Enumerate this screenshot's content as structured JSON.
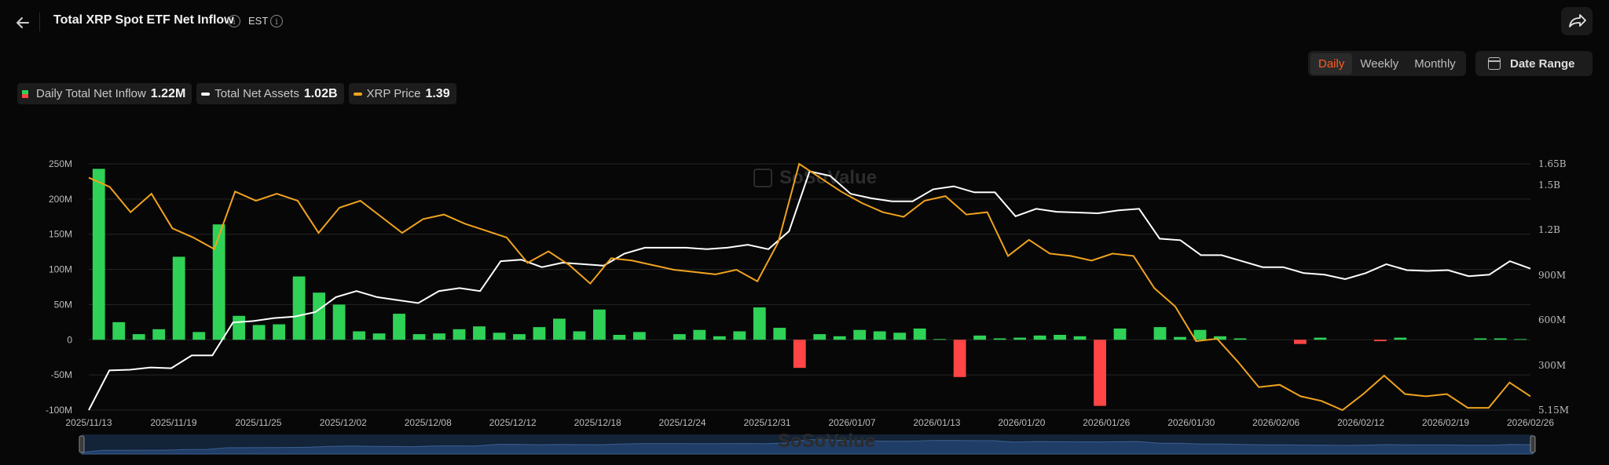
{
  "header": {
    "title": "Total XRP Spot ETF Net Inflow",
    "timezone": "EST"
  },
  "controls": {
    "periods": [
      "Daily",
      "Weekly",
      "Monthly"
    ],
    "active_period": "Daily",
    "date_range_label": "Date Range"
  },
  "legend": {
    "inflow": {
      "name": "Daily Total Net Inflow",
      "value": "1.22M"
    },
    "assets": {
      "name": "Total Net Assets",
      "value": "1.02B"
    },
    "price": {
      "name": "XRP Price",
      "value": "1.39"
    }
  },
  "watermark": "SoSoValue",
  "colors": {
    "positive": "#2fd157",
    "negative": "#ff4545",
    "assets_line": "#ffffff",
    "price_line": "#f0a31e",
    "accent": "#ff5a1f"
  },
  "chart_data": {
    "type": "bar",
    "x_tick_labels": [
      "2025/11/13",
      "2025/11/19",
      "2025/11/25",
      "2025/12/02",
      "2025/12/08",
      "2025/12/12",
      "2025/12/18",
      "2025/12/24",
      "2025/12/31",
      "2026/01/07",
      "2026/01/13",
      "2026/01/20",
      "2026/01/26",
      "2026/01/30",
      "2026/02/06",
      "2026/02/12",
      "2026/02/19",
      "2026/02/26"
    ],
    "y_left_ticks": [
      "250M",
      "200M",
      "150M",
      "100M",
      "50M",
      "0",
      "-50M",
      "-100M"
    ],
    "y_left_range": [
      -100,
      250
    ],
    "y_left_unit": "M",
    "y_right_ticks": [
      "1.65B",
      "1.5B",
      "1.2B",
      "900M",
      "600M",
      "300M",
      "5.15M"
    ],
    "grid": true,
    "legend_position": "top-left",
    "series": [
      {
        "name": "Daily Total Net Inflow",
        "axis": "left",
        "values": [
          243,
          25,
          8,
          15,
          118,
          11,
          164,
          34,
          21,
          22,
          90,
          67,
          50,
          12,
          9,
          37,
          8,
          9,
          15,
          19,
          10,
          8,
          18,
          30,
          12,
          43,
          7,
          11,
          0,
          8,
          14,
          5,
          12,
          46,
          17,
          -40,
          8,
          5,
          14,
          12,
          10,
          16,
          1,
          -53,
          6,
          2,
          3,
          6,
          7,
          5,
          -94,
          16,
          0,
          18,
          4,
          14,
          5,
          2,
          0,
          0,
          -6,
          3,
          0,
          0,
          -2,
          3,
          0,
          0,
          0,
          2,
          2,
          1
        ]
      },
      {
        "name": "Total Net Assets",
        "axis": "right",
        "values": [
          5,
          270,
          275,
          290,
          285,
          370,
          370,
          590,
          600,
          620,
          630,
          660,
          760,
          800,
          760,
          740,
          720,
          800,
          820,
          800,
          1000,
          1010,
          960,
          990,
          980,
          970,
          1050,
          1090,
          1090,
          1090,
          1080,
          1090,
          1110,
          1080,
          1200,
          1600,
          1570,
          1450,
          1420,
          1400,
          1400,
          1480,
          1500,
          1460,
          1460,
          1300,
          1350,
          1330,
          1325,
          1320,
          1340,
          1350,
          1150,
          1140,
          1040,
          1040,
          1000,
          960,
          960,
          920,
          910,
          880,
          920,
          980,
          940,
          935,
          940,
          900,
          910,
          1000,
          950
        ]
      },
      {
        "name": "XRP Price",
        "axis": "right",
        "values": [
          2.34,
          2.3,
          2.19,
          2.27,
          2.12,
          2.08,
          2.03,
          2.28,
          2.24,
          2.27,
          2.24,
          2.1,
          2.21,
          2.24,
          2.17,
          2.1,
          2.16,
          2.18,
          2.14,
          2.11,
          2.08,
          1.97,
          2.02,
          1.96,
          1.88,
          1.99,
          1.98,
          1.96,
          1.94,
          1.93,
          1.92,
          1.94,
          1.89,
          2.06,
          2.4,
          2.34,
          2.28,
          2.23,
          2.19,
          2.17,
          2.24,
          2.26,
          2.18,
          2.19,
          2.0,
          2.07,
          2.01,
          2.0,
          1.98,
          2.01,
          2.0,
          1.86,
          1.78,
          1.63,
          1.64,
          1.54,
          1.43,
          1.44,
          1.39,
          1.37,
          1.33,
          1.4,
          1.48,
          1.4,
          1.39,
          1.4,
          1.34,
          1.34,
          1.45,
          1.39
        ]
      }
    ]
  }
}
